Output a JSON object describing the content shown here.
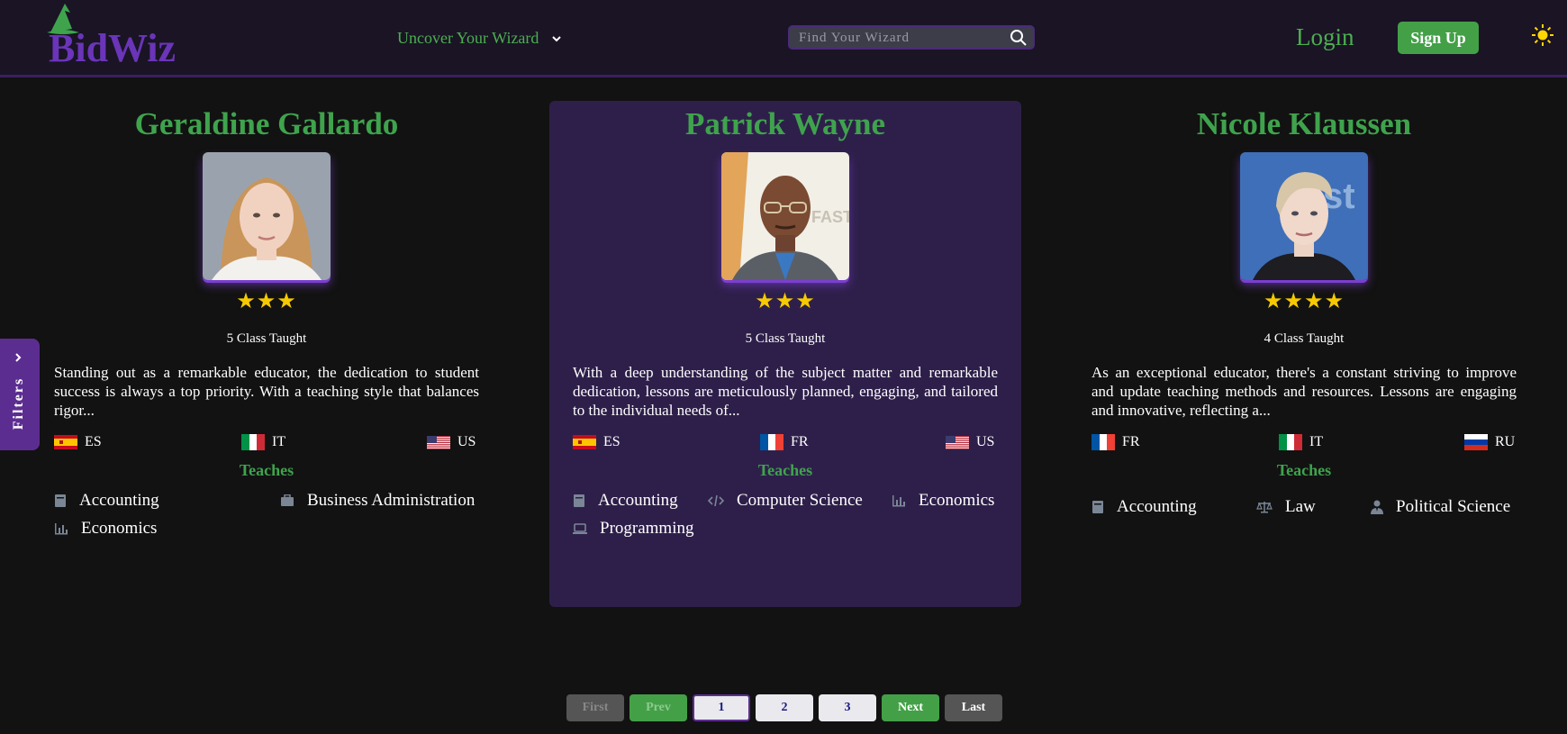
{
  "header": {
    "logo_text": "BidWiz",
    "nav_label": "Uncover Your Wizard",
    "search_placeholder": "Find Your Wizard",
    "login_label": "Login",
    "signup_label": "Sign Up"
  },
  "filters_label": "Filters",
  "colors": {
    "brand_purple": "#6a35b8",
    "accent_green": "#3fa34d",
    "card_highlight": "#2e1f4a",
    "star": "#f6c900"
  },
  "cards": [
    {
      "name": "Geraldine Gallardo",
      "stars": "★★★",
      "classes": "5 Class Taught",
      "description": "Standing out as a remarkable educator, the dedication to student success is always a top priority. With a teaching style that balances rigor...",
      "languages": [
        {
          "flag": "es-flag-icon",
          "code": "ES"
        },
        {
          "flag": "it-flag-icon",
          "code": "IT"
        },
        {
          "flag": "us-flag-icon",
          "code": "US"
        }
      ],
      "teaches_label": "Teaches",
      "subjects": [
        {
          "icon": "book-icon",
          "label": "Accounting"
        },
        {
          "icon": "briefcase-icon",
          "label": "Business Administration"
        },
        {
          "icon": "bar-chart-icon",
          "label": "Economics"
        }
      ]
    },
    {
      "name": "Patrick Wayne",
      "stars": "★★★",
      "classes": "5 Class Taught",
      "description": "With a deep understanding of the subject matter and remarkable dedication, lessons are meticulously planned, engaging, and tailored to the individual needs of...",
      "languages": [
        {
          "flag": "es-flag-icon",
          "code": "ES"
        },
        {
          "flag": "fr-flag-icon",
          "code": "FR"
        },
        {
          "flag": "us-flag-icon",
          "code": "US"
        }
      ],
      "teaches_label": "Teaches",
      "subjects": [
        {
          "icon": "book-icon",
          "label": "Accounting"
        },
        {
          "icon": "code-icon",
          "label": "Computer Science"
        },
        {
          "icon": "bar-chart-icon",
          "label": "Economics"
        },
        {
          "icon": "laptop-icon",
          "label": "Programming"
        }
      ]
    },
    {
      "name": "Nicole Klaussen",
      "stars": "★★★★",
      "classes": "4 Class Taught",
      "description": "As an exceptional educator, there's a constant striving to improve and update teaching methods and resources. Lessons are engaging and innovative, reflecting a...",
      "languages": [
        {
          "flag": "fr-flag-icon",
          "code": "FR"
        },
        {
          "flag": "it-flag-icon",
          "code": "IT"
        },
        {
          "flag": "ru-flag-icon",
          "code": "RU"
        }
      ],
      "teaches_label": "Teaches",
      "subjects": [
        {
          "icon": "book-icon",
          "label": "Accounting"
        },
        {
          "icon": "scale-icon",
          "label": "Law"
        },
        {
          "icon": "user-tie-icon",
          "label": "Political Science"
        }
      ]
    }
  ],
  "pagination": {
    "first": "First",
    "prev": "Prev",
    "pages": [
      "1",
      "2",
      "3"
    ],
    "current_page": "1",
    "next": "Next",
    "last": "Last"
  }
}
